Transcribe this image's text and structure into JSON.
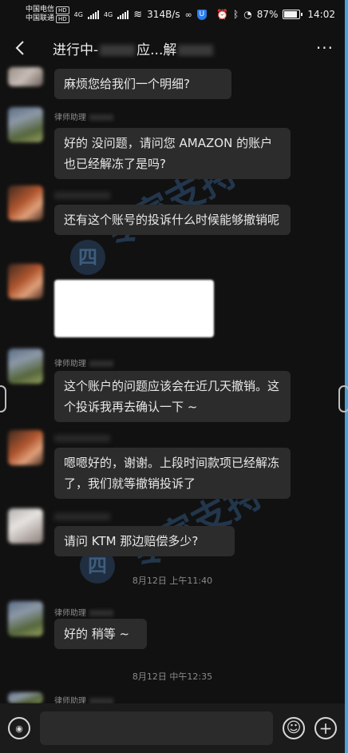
{
  "status_bar": {
    "carrier_1": "中国电信",
    "carrier_2": "中国联通",
    "hd": "HD",
    "network_1": "4G",
    "network_2": "4G",
    "net_speed": "314B/s",
    "battery_percent": "87%",
    "battery_level": 0.87,
    "time": "14:02"
  },
  "header": {
    "title_start": "进行中-",
    "title_mid": "应...解",
    "back_icon": "chevron-left-icon",
    "more_icon": "more-dots-icon",
    "more_glyph": "···"
  },
  "messages": [
    {
      "text": "麻烦您给我们一个明细?"
    },
    {
      "sender": "律师助理",
      "text": "好的 没问题，请问您 AMAZON 的账户也已经解冻了是吗?"
    },
    {
      "text": "还有这个账号的投诉什么时候能够撤销呢"
    },
    {
      "sender": "律师助理",
      "text": "这个账户的问题应该会在近几天撤销。这个投诉我再去确认一下 ~"
    },
    {
      "text": "嗯嗯好的，谢谢。上段时间款项已经解冻了，我们就等撤销投诉了"
    },
    {
      "text": "请问 KTM 那边赔偿多少?"
    },
    {
      "sender": "律师助理",
      "text": "好的 稍等 ~"
    },
    {
      "sender": "律师助理"
    }
  ],
  "timestamps": [
    "8月12日 上午11:40",
    "8月12日 中午12:35"
  ],
  "watermark": {
    "text": "专家支持",
    "logo_glyph": "四"
  },
  "input_bar": {
    "voice_icon": "voice-icon",
    "voice_glyph": "◉",
    "emoji_icon": "emoji-icon",
    "emoji_glyph": "☺",
    "plus_icon": "plus-icon",
    "plus_glyph": "+",
    "placeholder": ""
  }
}
